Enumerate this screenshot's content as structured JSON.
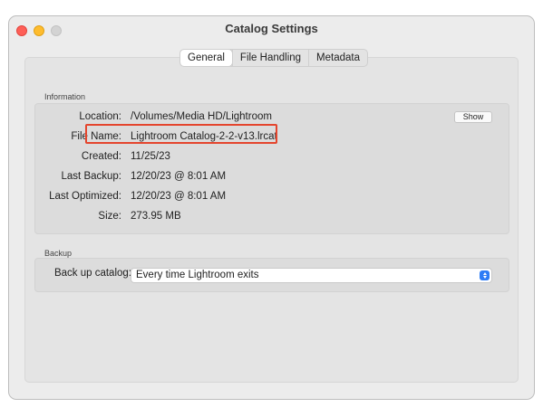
{
  "window": {
    "title": "Catalog Settings"
  },
  "tabs": [
    {
      "label": "General",
      "active": true
    },
    {
      "label": "File Handling",
      "active": false
    },
    {
      "label": "Metadata",
      "active": false
    }
  ],
  "information": {
    "section_title": "Information",
    "show_button": "Show",
    "rows": [
      {
        "label": "Location:",
        "value": "/Volumes/Media HD/Lightroom"
      },
      {
        "label": "File Name:",
        "value": "Lightroom Catalog-2-2-v13.lrcat"
      },
      {
        "label": "Created:",
        "value": "11/25/23"
      },
      {
        "label": "Last Backup:",
        "value": "12/20/23 @ 8:01 AM"
      },
      {
        "label": "Last Optimized:",
        "value": "12/20/23 @ 8:01 AM"
      },
      {
        "label": "Size:",
        "value": "273.95 MB"
      }
    ]
  },
  "backup": {
    "section_title": "Backup",
    "label": "Back up catalog:",
    "selected": "Every time Lightroom exits"
  },
  "colors": {
    "highlight": "#e4452d",
    "select_accent": "#2d7cf6",
    "close": "#fe5f57",
    "minimize": "#febc2e"
  }
}
